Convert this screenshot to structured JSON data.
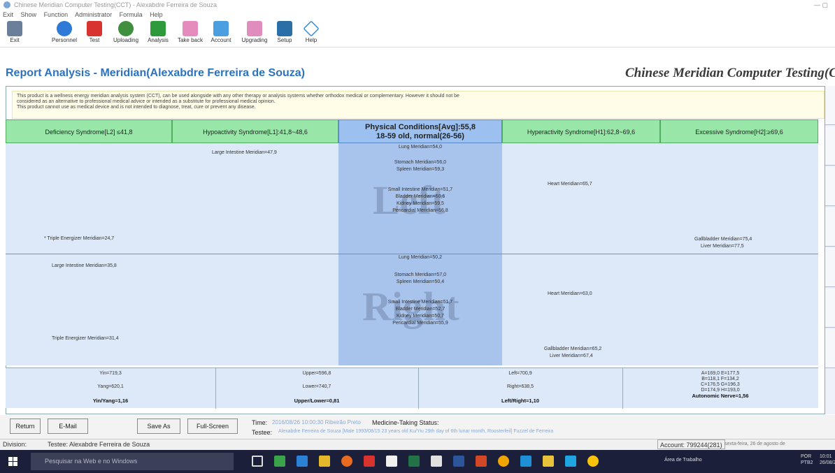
{
  "window": {
    "title": "Chinese Meridian Computer Testing(CCT) - Alexabdre Ferreira de Souza"
  },
  "menu": [
    "Exit",
    "Show",
    "Function",
    "Administrator",
    "Formula",
    "Help"
  ],
  "toolbar": [
    {
      "label": "Exit",
      "icon": "exit-icon"
    },
    {
      "label": "Personnel",
      "icon": "personnel-icon"
    },
    {
      "label": "Test",
      "icon": "test-icon"
    },
    {
      "label": "Uploading",
      "icon": "uploading-icon"
    },
    {
      "label": "Analysis",
      "icon": "analysis-icon"
    },
    {
      "label": "Take back",
      "icon": "takeback-icon"
    },
    {
      "label": "Account",
      "icon": "account-icon"
    },
    {
      "label": "Upgrading",
      "icon": "upgrading-icon"
    },
    {
      "label": "Setup",
      "icon": "setup-icon"
    },
    {
      "label": "Help",
      "icon": "help-icon"
    }
  ],
  "report": {
    "title": "Report Analysis - Meridian(Alexabdre Ferreira de Souza)",
    "brand": "Chinese Meridian Computer Testing(CC",
    "disclaimer": [
      "This product is a wellness energy meridian analysis system (CCT), can be used alongside with any other therapy or analysis systems whether orthodox medical or complementary. However it should not be",
      "considered as an alternative to professional medical advice or intended as a substitute for professional medical opinion.",
      "This product cannot use as medical device and is not intended to diagnose, treat, cure or prevent any disease."
    ],
    "nav_prev": "<<",
    "nav_next": ">>",
    "headers": {
      "deficiency": "Deficiency Syndrome[L2] ≤41,8",
      "hypoactivity": "Hypoactivity Syndrome[L1]:41,8~48,6",
      "center_line1": "Physical Conditions[Avg]:55,8",
      "center_line2": "18-59 old, normal(26-56)",
      "hyperactivity": "Hyperactivity Syndrome[H1]:62,8~69,6",
      "excessive": "Excessive Syndrome[H2]:≥69,6"
    },
    "watermark_left": "Left",
    "watermark_right": "Right",
    "left_side": {
      "large_intestine_l1": "Large Intestine Meridian=47,9",
      "triple_energizer_l2": "* Triple Energizer Meridian=24,7",
      "heart_h1": "Heart Meridian=65,7",
      "gallbladder_h2": "Gallbladder Meridian=75,4",
      "liver_h2": "Liver Meridian=77,5",
      "center": [
        "Lung Meridian=54,0",
        "Stomach Meridian=56,0",
        "Spleen Meridian=59,3",
        "Small Intestine Meridian=51,7",
        "Bladder Meridian=60,6",
        "Kidney Meridian=59,5",
        "Pericardial Meridian=56,8"
      ]
    },
    "right_side": {
      "large_intestine_l2": "Large Intestine Meridian=35,8",
      "triple_energizer_l2": "Triple Energizer Meridian=31,4",
      "heart_h1": "Heart Meridian=63,0",
      "gallbladder_h1": "Gallbladder Meridian=65,2",
      "liver_h1": "Liver Meridian=67,4",
      "center": [
        "Lung Meridian=50,2",
        "Stomach Meridian=57,0",
        "Spleen Meridian=50,4",
        "Small Intestine Meridian=51,7",
        "Bladder Meridian=52,7",
        "Kidney Meridian=50,7",
        "Pericardial Meridian=55,9"
      ]
    },
    "summary": {
      "yin": "Yin=719,3",
      "yang": "Yang=620,1",
      "yin_yang": "Yin/Yang=1,16",
      "upper": "Upper=596,8",
      "lower": "Lower=740,7",
      "upper_lower": "Upper/Lower=0,81",
      "left": "Left=700,9",
      "right": "Right=638,5",
      "left_right": "Left/Right=1,10",
      "abc1": "A=169,0  E=177,5",
      "abc2": "B=118,1  F=134,2",
      "abc3": "C=176,5  G=196,3",
      "abc4": "D=174,9  H=193,0",
      "autonomic": "Autonomic Nerve=1,56"
    }
  },
  "buttons": {
    "return": "Return",
    "email": "E-Mail",
    "save_as": "Save As",
    "full_screen": "Full-Screen"
  },
  "info": {
    "time_label": "Time:",
    "time_value": "2016/08/26 10:00:30 Ribeirão Preto",
    "medicine_label": "Medicine-Taking Status:",
    "testee_label": "Testee:",
    "testee_value": "Alexabdre Ferreira de Souza [Male 1993/08/15 23 years old Ku/Yiu 29th day of 6th lunar month, Roosterfeil] Fuzzel de Ferreira"
  },
  "status": {
    "division": "Division:",
    "testee": "Testee: Alexabdre Ferreira de Souza",
    "account": "Account: 799244(281)",
    "date": "sexta-feira, 26 de agosto de"
  },
  "taskbar": {
    "search_placeholder": "Pesquisar na Web e no Windows",
    "tray_text": "Área de Trabalho",
    "lang1": "POR",
    "lang2": "PTB2",
    "time": "10:01",
    "date": "26/08/20"
  },
  "colors": {
    "accent": "#2b72c0",
    "header_green": "#98e6a8",
    "center_blue": "#a9c4ec",
    "body_blue": "#dde9f8",
    "taskbar": "#1b1f3a"
  }
}
